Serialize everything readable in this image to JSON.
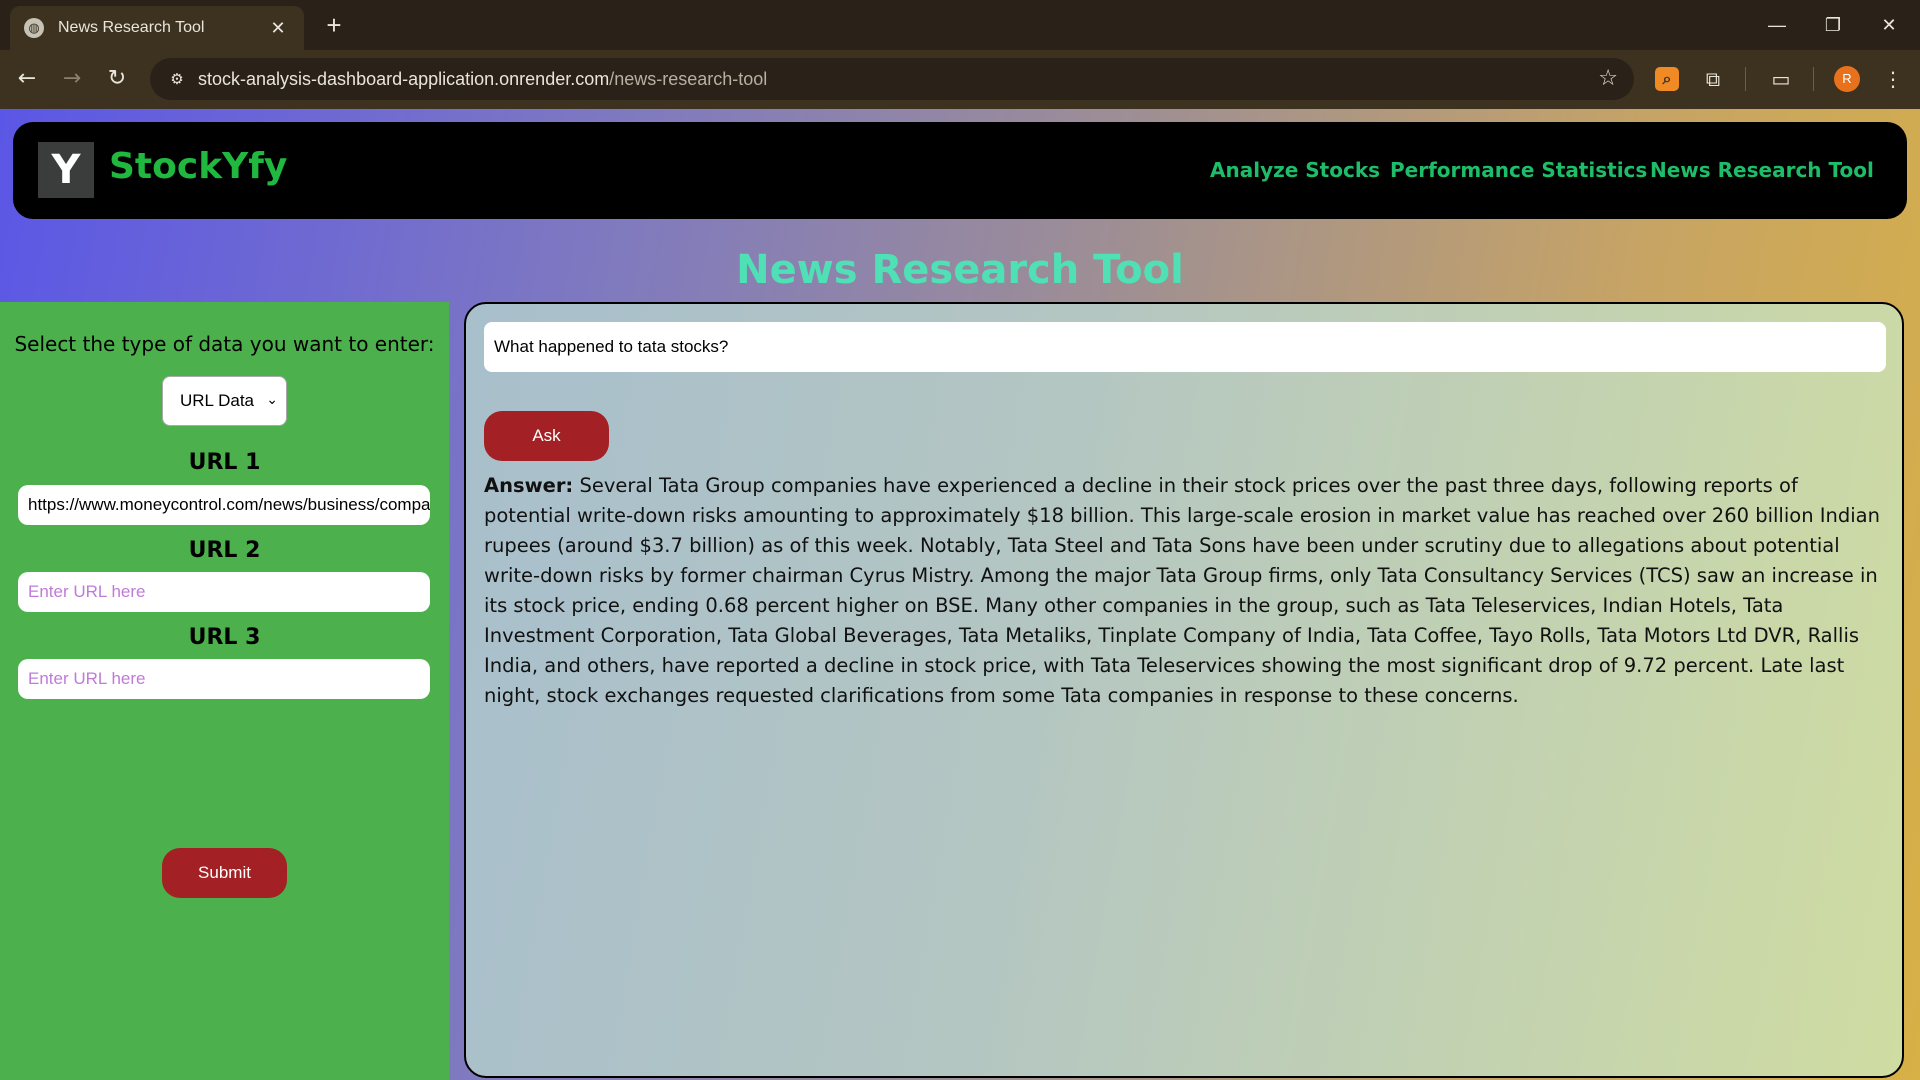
{
  "browser": {
    "tab_title": "News Research Tool",
    "tab_close": "✕",
    "new_tab": "+",
    "url_host": "stock-analysis-dashboard-application.onrender.com",
    "url_path": "/news-research-tool",
    "profile_initial": "R",
    "window_controls": {
      "minimize": "—",
      "restore": "❐",
      "close": "✕"
    }
  },
  "app": {
    "logo_letter": "Y",
    "brand": "StockYfy",
    "nav": [
      "Analyze Stocks",
      "Performance Statistics",
      "News Research Tool"
    ],
    "page_title": "News Research Tool"
  },
  "sidebar": {
    "prompt": "Select the type of data you want to enter:",
    "data_type_selected": "URL Data",
    "urls": [
      {
        "label": "URL 1",
        "value": "https://www.moneycontrol.com/news/business/compa",
        "placeholder": "Enter URL here"
      },
      {
        "label": "URL 2",
        "value": "",
        "placeholder": "Enter URL here"
      },
      {
        "label": "URL 3",
        "value": "",
        "placeholder": "Enter URL here"
      }
    ],
    "submit_label": "Submit"
  },
  "main": {
    "question": "What happened to tata stocks?",
    "ask_label": "Ask",
    "answer_label": "Answer:",
    "answer_text": "Several Tata Group companies have experienced a decline in their stock prices over the past three days, following reports of potential write-down risks amounting to approximately $18 billion. This large-scale erosion in market value has reached over 260 billion Indian rupees (around $3.7 billion) as of this week. Notably, Tata Steel and Tata Sons have been under scrutiny due to allegations about potential write-down risks by former chairman Cyrus Mistry. Among the major Tata Group firms, only Tata Consultancy Services (TCS) saw an increase in its stock price, ending 0.68 percent higher on BSE. Many other companies in the group, such as Tata Teleservices, Indian Hotels, Tata Investment Corporation, Tata Global Beverages, Tata Metaliks, Tinplate Company of India, Tata Coffee, Tayo Rolls, Tata Motors Ltd DVR, Rallis India, and others, have reported a decline in stock price, with Tata Teleservices showing the most significant drop of 9.72 percent. Late last night, stock exchanges requested clarifications from some Tata companies in response to these concerns."
  },
  "colors": {
    "brand_green": "#20b83f",
    "nav_green": "#1ebd6a",
    "title_teal": "#4fe0b5",
    "sidebar_green": "#4cb14c",
    "button_red": "#a32024"
  }
}
